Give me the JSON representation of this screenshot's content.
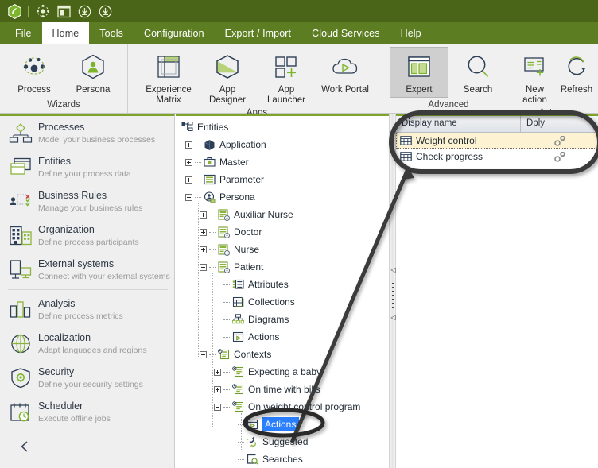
{
  "titlebar": {
    "icons": [
      {
        "name": "app-logo-icon",
        "label": "Bizagi"
      },
      {
        "name": "process-nav-icon",
        "label": "Process navigation"
      },
      {
        "name": "window-layout-icon",
        "label": "Window layout"
      },
      {
        "name": "download-icon-1",
        "label": "Download"
      },
      {
        "name": "download-icon-2",
        "label": "Download"
      }
    ]
  },
  "menubar": {
    "items": [
      {
        "label": "File",
        "active": false
      },
      {
        "label": "Home",
        "active": true
      },
      {
        "label": "Tools",
        "active": false
      },
      {
        "label": "Configuration",
        "active": false
      },
      {
        "label": "Export / Import",
        "active": false
      },
      {
        "label": "Cloud Services",
        "active": false
      },
      {
        "label": "Help",
        "active": false
      }
    ]
  },
  "ribbon": {
    "groups": [
      {
        "title": "Wizards",
        "buttons": [
          {
            "label": "Process",
            "icon": "process-diagram-icon",
            "selected": false
          },
          {
            "label": "Persona",
            "icon": "persona-hexagon-icon",
            "selected": false
          }
        ]
      },
      {
        "title": "Apps",
        "buttons": [
          {
            "label": "Experience Matrix",
            "icon": "matrix-grid-icon",
            "selected": false
          },
          {
            "label": "App Designer",
            "icon": "hexagon-designer-icon",
            "selected": false
          },
          {
            "label": "App Launcher",
            "icon": "squares-plus-icon",
            "selected": false
          },
          {
            "label": "Work Portal",
            "icon": "cloud-play-icon",
            "selected": false
          }
        ]
      },
      {
        "title": "Advanced",
        "buttons": [
          {
            "label": "Expert",
            "icon": "expert-panels-icon",
            "selected": true
          },
          {
            "label": "Search",
            "icon": "search-icon",
            "selected": false
          }
        ]
      },
      {
        "title": "Actions",
        "buttons": [
          {
            "label": "New action",
            "icon": "new-action-icon",
            "selected": false
          },
          {
            "label": "Refresh",
            "icon": "refresh-icon",
            "selected": false
          }
        ]
      }
    ]
  },
  "sidebar": {
    "items": [
      {
        "title": "Processes",
        "subtitle": "Model your business processes",
        "icon": "processes-icon"
      },
      {
        "title": "Entities",
        "subtitle": "Define your process data",
        "icon": "entities-icon"
      },
      {
        "title": "Business  Rules",
        "subtitle": "Manage your business rules",
        "icon": "business-rules-icon"
      },
      {
        "title": "Organization",
        "subtitle": "Define process participants",
        "icon": "organization-icon"
      },
      {
        "title": "External systems",
        "subtitle": "Connect with your external systems",
        "icon": "external-systems-icon"
      },
      {
        "title": "Analysis",
        "subtitle": "Define  process  metrics",
        "icon": "analysis-icon"
      },
      {
        "title": "Localization",
        "subtitle": "Adapt languages  and regions",
        "icon": "localization-icon"
      },
      {
        "title": "Security",
        "subtitle": "Define  your security  settings",
        "icon": "security-icon"
      },
      {
        "title": "Scheduler",
        "subtitle": "Execute offline jobs",
        "icon": "scheduler-icon"
      }
    ],
    "separator_after_index": 4,
    "collapse_icon": "chevron-left-icon"
  },
  "tree": {
    "nodes": [
      {
        "label": "Entities",
        "depth": 0,
        "toggle": "none",
        "icon": "entities-root-icon",
        "selected": false
      },
      {
        "label": "Application",
        "depth": 1,
        "toggle": "plus",
        "icon": "application-icon",
        "selected": false
      },
      {
        "label": "Master",
        "depth": 1,
        "toggle": "plus",
        "icon": "master-icon",
        "selected": false
      },
      {
        "label": "Parameter",
        "depth": 1,
        "toggle": "plus",
        "icon": "parameter-icon",
        "selected": false
      },
      {
        "label": "Persona",
        "depth": 1,
        "toggle": "minus",
        "icon": "persona-icon",
        "selected": false
      },
      {
        "label": "Auxiliar Nurse",
        "depth": 2,
        "toggle": "plus",
        "icon": "entity-icon",
        "selected": false
      },
      {
        "label": "Doctor",
        "depth": 2,
        "toggle": "plus",
        "icon": "entity-icon",
        "selected": false
      },
      {
        "label": "Nurse",
        "depth": 2,
        "toggle": "plus",
        "icon": "entity-icon",
        "selected": false
      },
      {
        "label": "Patient",
        "depth": 2,
        "toggle": "minus",
        "icon": "entity-icon",
        "selected": false
      },
      {
        "label": "Attributes",
        "depth": 3,
        "toggle": "leaf",
        "icon": "attributes-icon",
        "selected": false
      },
      {
        "label": "Collections",
        "depth": 3,
        "toggle": "leaf",
        "icon": "collections-icon",
        "selected": false
      },
      {
        "label": "Diagrams",
        "depth": 3,
        "toggle": "leaf",
        "icon": "diagrams-icon",
        "selected": false
      },
      {
        "label": "Actions",
        "depth": 3,
        "toggle": "leaf",
        "icon": "actions-icon",
        "selected": false
      },
      {
        "label": "Contexts",
        "depth": 3,
        "toggle": "minus",
        "icon": "contexts-icon",
        "selected": false
      },
      {
        "label": "Expecting a baby",
        "depth": 4,
        "toggle": "plus",
        "icon": "context-icon",
        "selected": false
      },
      {
        "label": "On time with bills",
        "depth": 4,
        "toggle": "plus",
        "icon": "context-icon",
        "selected": false
      },
      {
        "label": "On weight control program",
        "depth": 4,
        "toggle": "minus",
        "icon": "context-icon",
        "selected": false
      },
      {
        "label": "Actions",
        "depth": 5,
        "toggle": "leaf",
        "icon": "actions-icon",
        "selected": true
      },
      {
        "label": "Suggested",
        "depth": 5,
        "toggle": "leaf",
        "icon": "suggested-link-icon",
        "selected": false
      },
      {
        "label": "Searches",
        "depth": 5,
        "toggle": "leaf",
        "icon": "searches-icon",
        "selected": false
      }
    ]
  },
  "splitter": {
    "collapse_icon_top": "collapse-left-arrow-icon",
    "collapse_icon_bottom": "collapse-left-arrow-icon",
    "grip": "splitter-grip"
  },
  "grid": {
    "columns": [
      {
        "label": "Display name"
      },
      {
        "label": "Dply"
      }
    ],
    "rows": [
      {
        "display_name": "Weight control",
        "icon": "grid-row-icon",
        "action_icon": "gear-action-icon",
        "selected": true
      },
      {
        "display_name": "Check progress",
        "icon": "grid-row-icon",
        "action_icon": "gear-action-icon",
        "selected": false
      }
    ]
  },
  "annotations": {
    "ellipse_grid": "highlight-ellipse-around-grid",
    "ellipse_tree": "highlight-ellipse-around-actions-node",
    "arrow": "arrow-from-tree-actions-to-grid"
  },
  "colors": {
    "title_bar": "#4a6418",
    "menu_bar": "#5c7d22",
    "accent_green": "#7ba428",
    "icon_navy": "#2e4057",
    "selection_blue": "#2a7fff",
    "row_highlight": "#fdf3d2",
    "sidebar_bg": "#efefef"
  }
}
